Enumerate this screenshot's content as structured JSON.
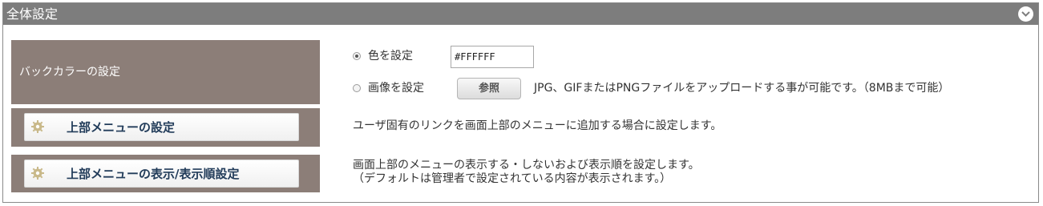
{
  "panel": {
    "title": "全体設定",
    "collapse_icon": "chevron-down-icon"
  },
  "background_setting": {
    "label": "バックカラーの設定",
    "color_option": {
      "label": "色を設定",
      "selected": true
    },
    "color_value": "#FFFFFF",
    "image_option": {
      "label": "画像を設定",
      "selected": false
    },
    "browse_label": "参照",
    "image_hint": "JPG、GIFまたはPNGファイルをアップロードする事が可能です。（8MBまで可能）"
  },
  "top_menu_setting": {
    "button_label": "上部メニューの設定",
    "icon": "gear-icon",
    "description": "ユーザ固有のリンクを画面上部のメニューに追加する場合に設定します。"
  },
  "top_menu_display": {
    "button_label": "上部メニューの表示/表示順設定",
    "icon": "gear-icon",
    "description_line1": "画面上部のメニューの表示する・しないおよび表示順を設定します。",
    "description_line2": "（デフォルトは管理者で設定されている内容が表示されます。）"
  },
  "colors": {
    "header_bg": "#7d7d7d",
    "label_bg": "#8c7e78",
    "button_text": "#223c5a"
  }
}
